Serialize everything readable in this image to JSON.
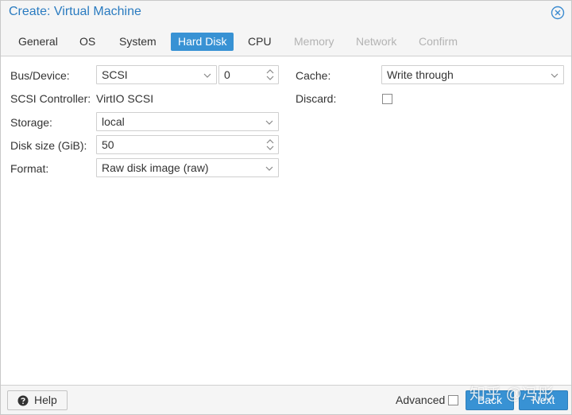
{
  "window": {
    "title": "Create: Virtual Machine"
  },
  "tabs": [
    {
      "label": "General",
      "state": "normal"
    },
    {
      "label": "OS",
      "state": "normal"
    },
    {
      "label": "System",
      "state": "normal"
    },
    {
      "label": "Hard Disk",
      "state": "active"
    },
    {
      "label": "CPU",
      "state": "normal"
    },
    {
      "label": "Memory",
      "state": "disabled"
    },
    {
      "label": "Network",
      "state": "disabled"
    },
    {
      "label": "Confirm",
      "state": "disabled"
    }
  ],
  "form": {
    "bus_device": {
      "label": "Bus/Device:",
      "bus": "SCSI",
      "device": "0"
    },
    "scsi_controller": {
      "label": "SCSI Controller:",
      "value": "VirtIO SCSI"
    },
    "storage": {
      "label": "Storage:",
      "value": "local"
    },
    "disk_size": {
      "label": "Disk size (GiB):",
      "value": "50"
    },
    "format": {
      "label": "Format:",
      "value": "Raw disk image (raw)"
    },
    "cache": {
      "label": "Cache:",
      "value": "Write through"
    },
    "discard": {
      "label": "Discard:",
      "checked": false
    }
  },
  "footer": {
    "help_label": "Help",
    "advanced_label": "Advanced",
    "advanced_checked": false,
    "back_label": "Back",
    "next_label": "Next"
  },
  "watermark": "知乎 @冯彤",
  "colors": {
    "accent": "#3892d4",
    "title": "#2a7bc0",
    "disabled": "#b3b3b3"
  },
  "icons": {
    "close": "close-circle-icon",
    "help": "question-circle-icon",
    "select": "chevron-down-icon",
    "spinner": "spinner-arrows-icon"
  }
}
